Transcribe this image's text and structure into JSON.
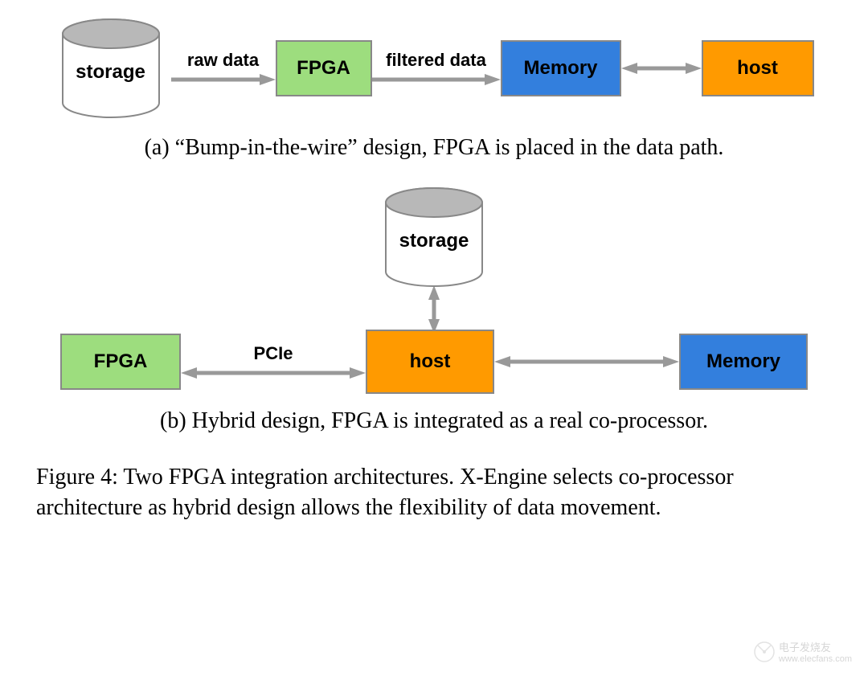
{
  "arch_a": {
    "storage_label": "storage",
    "arrow1_label": "raw data",
    "fpga_label": "FPGA",
    "arrow2_label": "filtered data",
    "memory_label": "Memory",
    "host_label": "host",
    "caption": "(a) “Bump-in-the-wire” design, FPGA is placed in the data path."
  },
  "arch_b": {
    "storage_label": "storage",
    "fpga_label": "FPGA",
    "arrow1_label": "PCIe",
    "host_label": "host",
    "memory_label": "Memory",
    "caption": "(b) Hybrid design, FPGA is integrated as a real co-processor."
  },
  "figure_caption": "Figure 4: Two FPGA integration architectures. X-Engine selects co-processor architecture as hybrid design allows the flexibility of data movement.",
  "watermark": {
    "brand": "电子发烧友",
    "url": "www.elecfans.com"
  }
}
